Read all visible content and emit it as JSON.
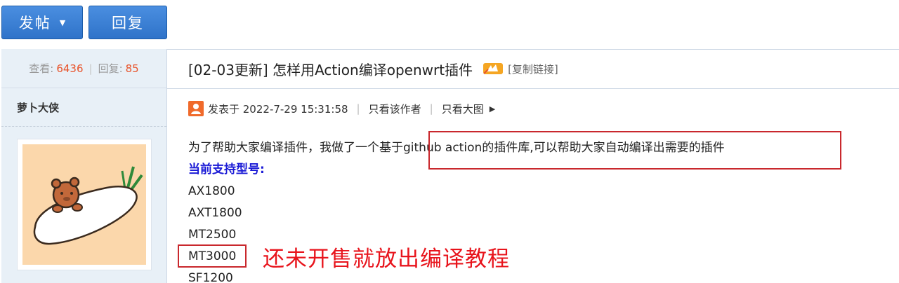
{
  "toolbar": {
    "post_label": "发帖",
    "reply_label": "回复"
  },
  "stats": {
    "views_label": "查看:",
    "views_value": "6436",
    "replies_label": "回复:",
    "replies_value": "85"
  },
  "author": {
    "name": "萝卜大侠"
  },
  "thread": {
    "title": "[02-03更新] 怎样用Action编译openwrt插件",
    "copy_link": "[复制链接]"
  },
  "post_meta": {
    "posted_at": "发表于 2022-7-29 15:31:58",
    "only_author": "只看该作者",
    "only_large_images": "只看大图"
  },
  "post_body": {
    "intro": "为了帮助大家编译插件，我做了一个基于github action的插件库,可以帮助大家自动编译出需要的插件",
    "models_heading": "当前支持型号:",
    "models": [
      "AX1800",
      "AXT1800",
      "MT2500",
      "MT3000",
      "SF1200"
    ]
  },
  "annotation": {
    "note": "还未开售就放出编译教程"
  },
  "colors": {
    "button_blue": "#2f73c9",
    "sidebar_bg": "#e8f0f7",
    "accent_orange": "#e8532a",
    "heading_blue": "#1a1ad6",
    "annotation_red": "#e8141c"
  }
}
